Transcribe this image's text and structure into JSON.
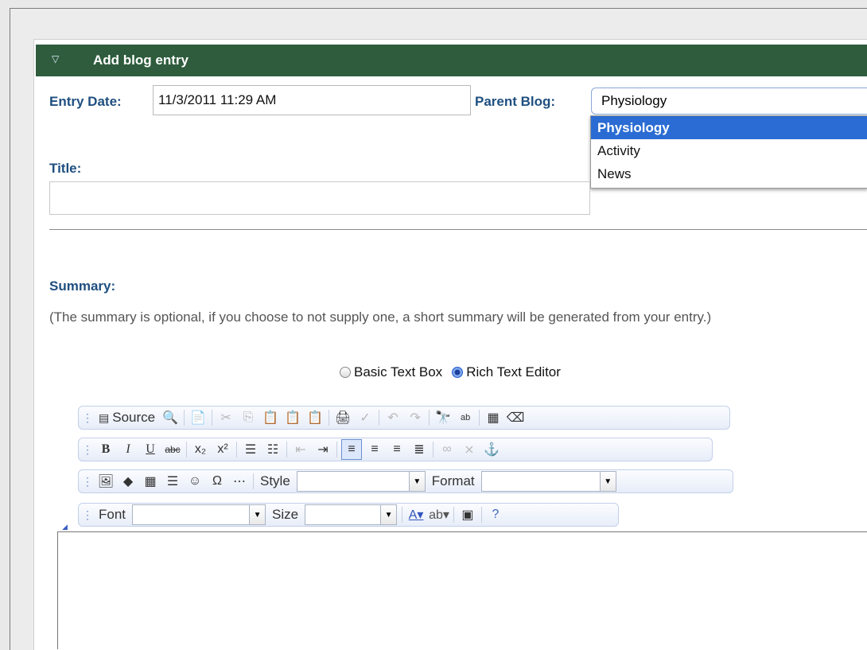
{
  "header": {
    "title": "Add blog entry"
  },
  "form": {
    "entry_date_label": "Entry Date:",
    "entry_date_value": "11/3/2011 11:29 AM",
    "parent_blog_label": "Parent Blog:",
    "parent_blog_value": "Physiology",
    "parent_blog_options": [
      "Physiology",
      "Activity",
      "News"
    ],
    "title_label": "Title:",
    "title_value": "",
    "summary_label": "Summary:",
    "summary_note": "(The summary is optional, if you choose to not supply one, a short summary will be generated from your entry.)",
    "editor_mode_options": [
      "Basic Text Box",
      "Rich Text Editor"
    ],
    "editor_mode_selected": "Rich Text Editor"
  },
  "toolbar": {
    "source_label": "Source",
    "style_label": "Style",
    "format_label": "Format",
    "font_label": "Font",
    "size_label": "Size"
  },
  "colors": {
    "header_bg": "#2e5c3d",
    "label": "#1f4f80",
    "selection": "#2a6cd3"
  }
}
